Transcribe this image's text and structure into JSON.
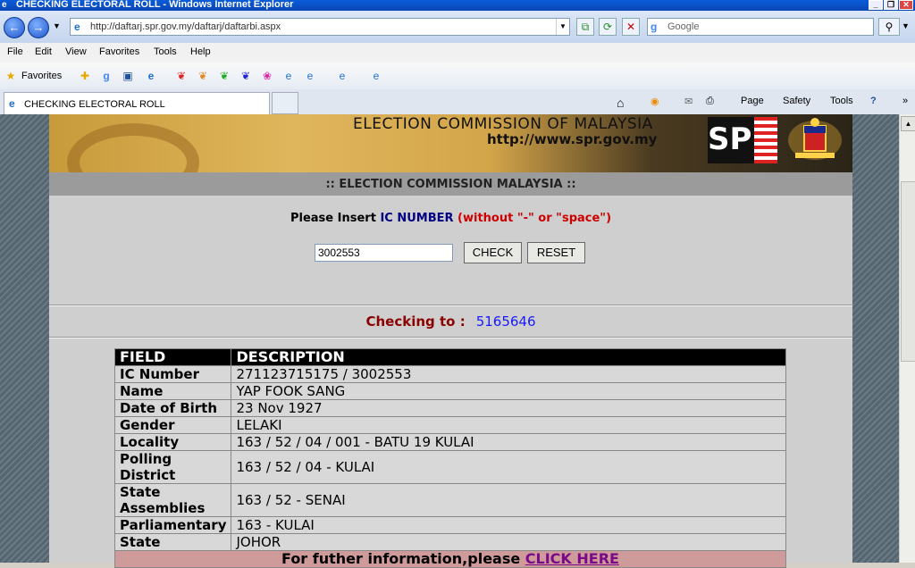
{
  "window": {
    "title": "CHECKING ELECTORAL ROLL - Windows Internet Explorer"
  },
  "address": {
    "url": "http://daftarj.spr.gov.my/daftarj/daftarbi.aspx"
  },
  "search": {
    "placeholder": "Google"
  },
  "menu": [
    "File",
    "Edit",
    "View",
    "Favorites",
    "Tools",
    "Help"
  ],
  "favorites": {
    "label": "Favorites"
  },
  "tab": {
    "label": "CHECKING ELECTORAL ROLL"
  },
  "commands": {
    "page": "Page",
    "safety": "Safety",
    "tools": "Tools"
  },
  "banner": {
    "title": "ELECTION COMMISSION OF MALAYSIA",
    "url": "http://www.spr.gov.my",
    "logo": "SPR"
  },
  "section": {
    "header": ":: ELECTION COMMISSION MALAYSIA ::"
  },
  "form": {
    "prompt_a": "Please Insert ",
    "prompt_b": "IC NUMBER",
    "prompt_c": " (without \"-\" or \"space\")",
    "ic_value": "3002553",
    "check_label": "CHECK",
    "reset_label": "RESET"
  },
  "checking": {
    "label": "Checking to :",
    "value": "5165646"
  },
  "table": {
    "headers": [
      "FIELD",
      "DESCRIPTION"
    ],
    "rows": [
      {
        "field": "IC Number",
        "value": "271123715175 / 3002553"
      },
      {
        "field": "Name",
        "value": "YAP FOOK SANG"
      },
      {
        "field": "Date of Birth",
        "value": "23 Nov 1927"
      },
      {
        "field": "Gender",
        "value": "LELAKI"
      },
      {
        "field": "Locality",
        "value": "163 / 52 / 04 / 001 - BATU 19 KULAI"
      },
      {
        "field": "Polling District",
        "value": "163 / 52 / 04 - KULAI"
      },
      {
        "field": "State Assemblies",
        "value": "163 / 52 - SENAI"
      },
      {
        "field": "Parliamentary",
        "value": "163 - KULAI"
      },
      {
        "field": "State",
        "value": "JOHOR"
      }
    ],
    "footer_text": "For futher information,please ",
    "footer_link": "CLICK HERE"
  }
}
